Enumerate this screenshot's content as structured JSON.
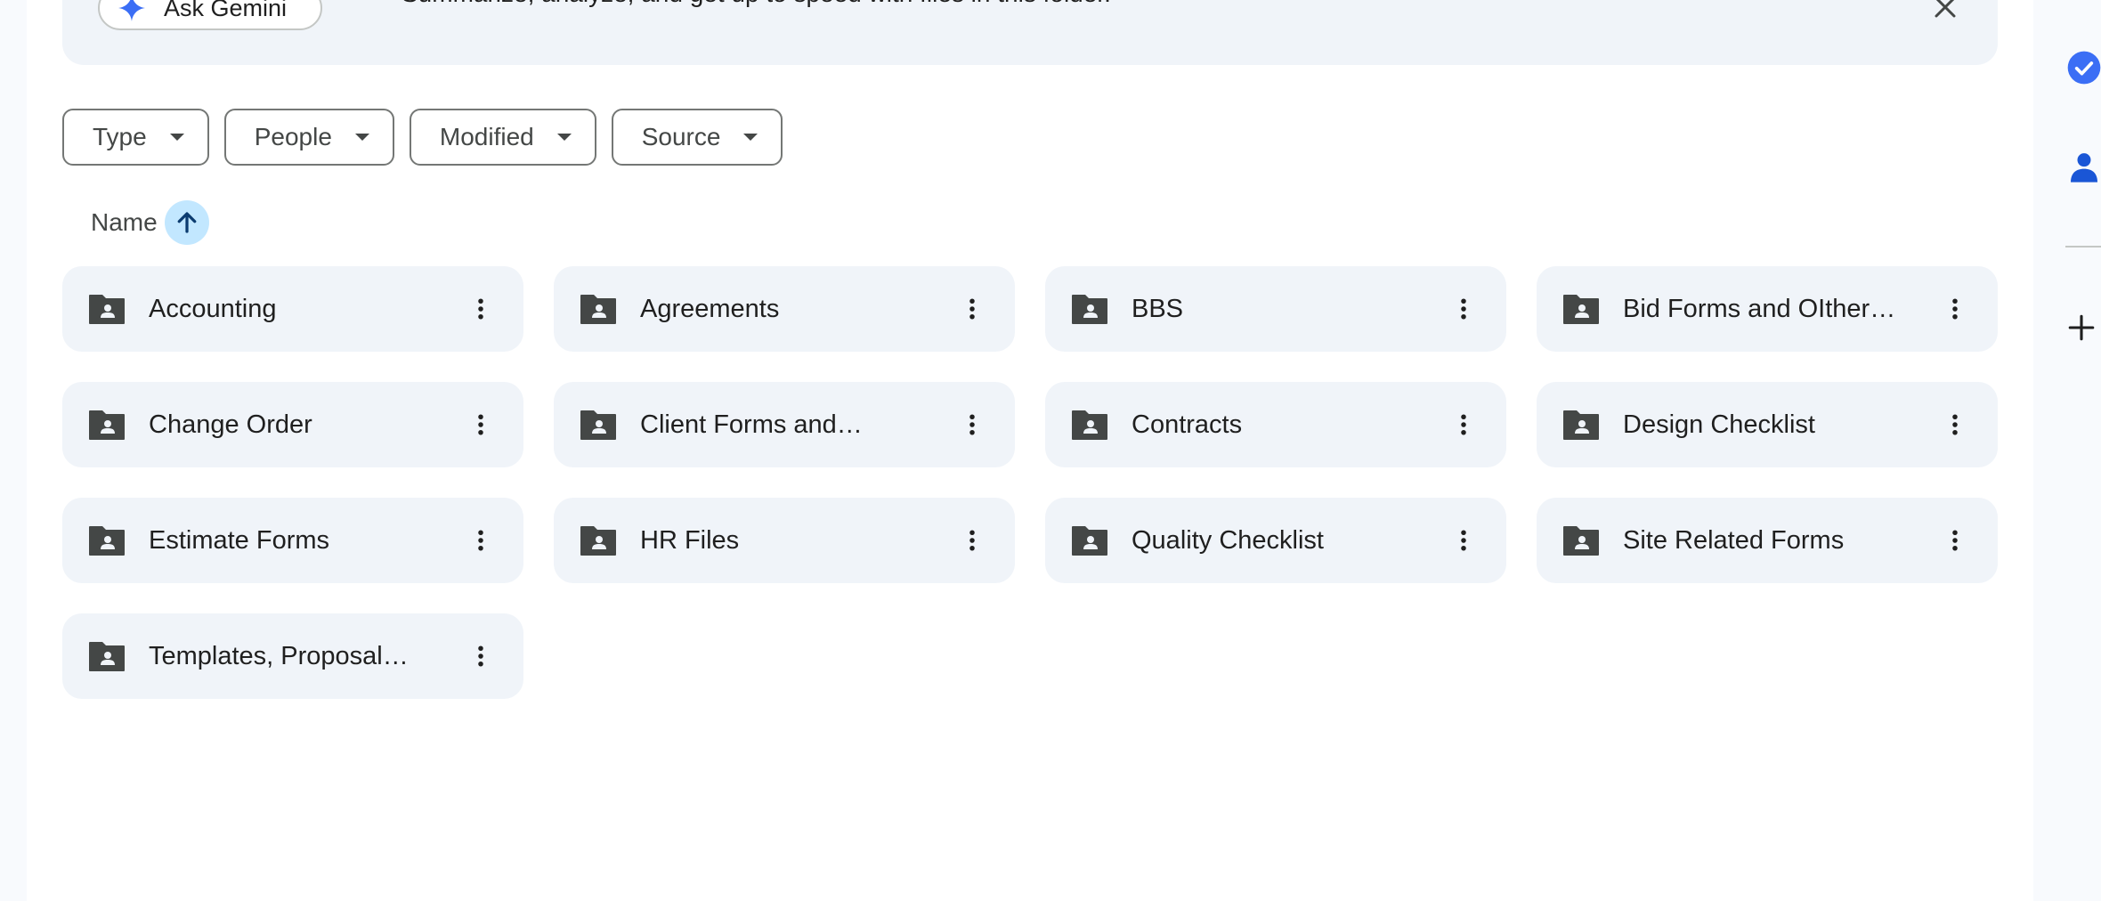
{
  "banner": {
    "ask_label": "Ask Gemini",
    "text": "Summarize, analyze, and get up to speed with files in this folder."
  },
  "filters": [
    {
      "label": "Type"
    },
    {
      "label": "People"
    },
    {
      "label": "Modified"
    },
    {
      "label": "Source"
    }
  ],
  "sort": {
    "label": "Name",
    "direction": "ascending"
  },
  "folders": [
    {
      "name": "Accounting"
    },
    {
      "name": "Agreements"
    },
    {
      "name": "BBS"
    },
    {
      "name": "Bid Forms and OIther…"
    },
    {
      "name": "Change Order"
    },
    {
      "name": "Client Forms and…"
    },
    {
      "name": "Contracts"
    },
    {
      "name": "Design Checklist"
    },
    {
      "name": "Estimate Forms"
    },
    {
      "name": "HR Files"
    },
    {
      "name": "Quality Checklist"
    },
    {
      "name": "Site Related Forms"
    },
    {
      "name": "Templates, Proposal…"
    }
  ],
  "colors": {
    "accent": "#0b57d0",
    "sort_bg": "#c2e7ff",
    "card_bg": "#f0f4f9",
    "folder_icon": "#444746"
  },
  "icons": {
    "folder": "shared-folder-icon",
    "more": "more-vert-icon",
    "ask": "gemini-spark-icon",
    "close": "close-icon",
    "sort": "arrow-up-icon",
    "side": [
      "tasks-icon",
      "contacts-icon",
      "add-icon"
    ]
  }
}
